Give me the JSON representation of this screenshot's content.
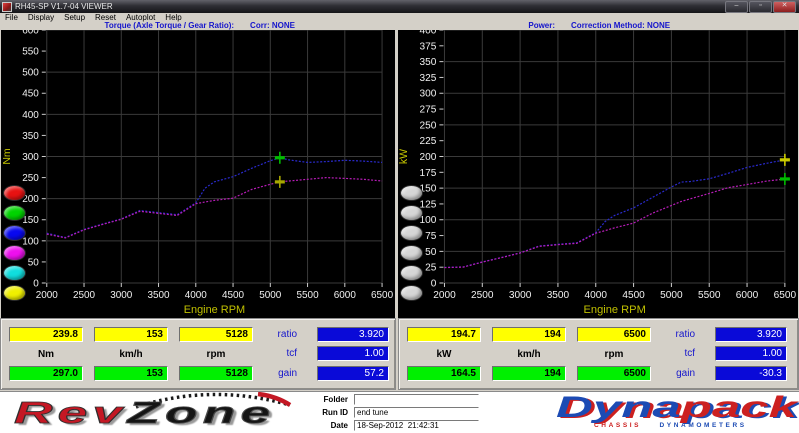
{
  "window": {
    "title": "RH45-SP V1.7-04  VIEWER",
    "minimize_glyph": "–",
    "maximize_glyph": "▫",
    "close_glyph": "✕"
  },
  "menu": {
    "items": [
      "File",
      "Display",
      "Setup",
      "Reset",
      "Autoplot",
      "Help"
    ]
  },
  "panels": [
    {
      "title": "Torque (Axle Torque / Gear Ratio):",
      "correction": "Corr: NONE",
      "readout": {
        "row1": [
          "239.8",
          "153",
          "5128"
        ],
        "units": [
          "Nm",
          "km/h",
          "rpm"
        ],
        "row2": [
          "297.0",
          "153",
          "5128"
        ],
        "ratio_label": "ratio",
        "ratio": "3.920",
        "tcf_label": "tcf",
        "tcf": "1.00",
        "gain_label": "gain",
        "gain": "57.2"
      }
    },
    {
      "title": "Power:",
      "correction": "Correction Method: NONE",
      "readout": {
        "row1": [
          "194.7",
          "194",
          "6500"
        ],
        "units": [
          "kW",
          "km/h",
          "rpm"
        ],
        "row2": [
          "164.5",
          "194",
          "6500"
        ],
        "ratio_label": "ratio",
        "ratio": "3.920",
        "tcf_label": "tcf",
        "tcf": "1.00",
        "gain_label": "gain",
        "gain": "-30.3"
      }
    }
  ],
  "run_buttons": {
    "left": [
      "#e81212",
      "#00d400",
      "#0808f0",
      "#ee10ee",
      "#10dede",
      "#f0f000"
    ],
    "right": [
      "#d6d6d6",
      "#d6d6d6",
      "#d6d6d6",
      "#d6d6d6",
      "#d6d6d6",
      "#d6d6d6"
    ]
  },
  "footer": {
    "folder_label": "Folder",
    "folder_value": "",
    "runid_label": "Run ID",
    "runid_value": "end tune",
    "date_label": "Date",
    "date_value": "18-Sep-2012  21:42:31"
  },
  "logos": {
    "revzone": {
      "part1": "Rev",
      "part2": "Zone"
    },
    "dynapack": {
      "part1": "Dyna",
      "part2": "pack",
      "sub1": "CHASSIS",
      "sub2": "DYNAMOMETERS"
    }
  },
  "chart_data": [
    {
      "type": "line",
      "title": "Torque (Axle Torque / Gear Ratio)",
      "xlabel": "Engine RPM",
      "ylabel": "Nm",
      "xlim": [
        2000,
        6500
      ],
      "ylim": [
        0,
        600
      ],
      "xtick_step": 500,
      "ytick_step": 50,
      "grid_y_step": 100,
      "grid": true,
      "x": [
        2000,
        2250,
        2500,
        2750,
        3000,
        3250,
        3500,
        3750,
        4000,
        4125,
        4250,
        4500,
        4750,
        5000,
        5128,
        5250,
        5500,
        5750,
        6000,
        6250,
        6500
      ],
      "series": [
        {
          "name": "run-blue",
          "color": "#2a2ace",
          "values": [
            118,
            108,
            127,
            140,
            152,
            172,
            167,
            162,
            190,
            225,
            240,
            252,
            272,
            290,
            297,
            292,
            286,
            288,
            291,
            289,
            286
          ]
        },
        {
          "name": "run-magenta",
          "color": "#b81cb8",
          "values": [
            116,
            107,
            126,
            139,
            151,
            170,
            165,
            160,
            188,
            192,
            196,
            201,
            222,
            234,
            240,
            242,
            246,
            250,
            248,
            246,
            242
          ]
        }
      ],
      "cursors": [
        {
          "color": "#00bb00",
          "x": 5128,
          "y": 297.0
        },
        {
          "color": "#a8a800",
          "x": 5128,
          "y": 239.8
        }
      ]
    },
    {
      "type": "line",
      "title": "Power",
      "xlabel": "Engine RPM",
      "ylabel": "kW",
      "xlim": [
        2000,
        6500
      ],
      "ylim": [
        0,
        400
      ],
      "xtick_step": 500,
      "ytick_step": 25,
      "grid_y_step": 50,
      "grid": true,
      "x": [
        2000,
        2250,
        2500,
        2750,
        3000,
        3250,
        3500,
        3750,
        4000,
        4125,
        4250,
        4500,
        4750,
        5000,
        5128,
        5250,
        5500,
        5750,
        6000,
        6250,
        6500
      ],
      "series": [
        {
          "name": "run-blue",
          "color": "#2a2ace",
          "values": [
            24.7,
            25.4,
            33.2,
            40.3,
            47.8,
            58.5,
            61.2,
            63.6,
            79.6,
            97.2,
            106.8,
            118.8,
            135.3,
            151.8,
            159.5,
            160.5,
            164.7,
            173.4,
            182.8,
            189.1,
            194.7
          ]
        },
        {
          "name": "run-magenta",
          "color": "#b81cb8",
          "values": [
            24.3,
            25.2,
            33.0,
            40.0,
            47.4,
            57.9,
            60.5,
            62.8,
            78.7,
            82.9,
            87.2,
            94.7,
            110.4,
            122.5,
            128.9,
            133.1,
            141.7,
            150.6,
            155.8,
            161.0,
            164.5
          ]
        }
      ],
      "cursors": [
        {
          "color": "#cccc00",
          "x": 6500,
          "y": 194.7
        },
        {
          "color": "#00bb00",
          "x": 6500,
          "y": 164.5
        }
      ]
    }
  ]
}
